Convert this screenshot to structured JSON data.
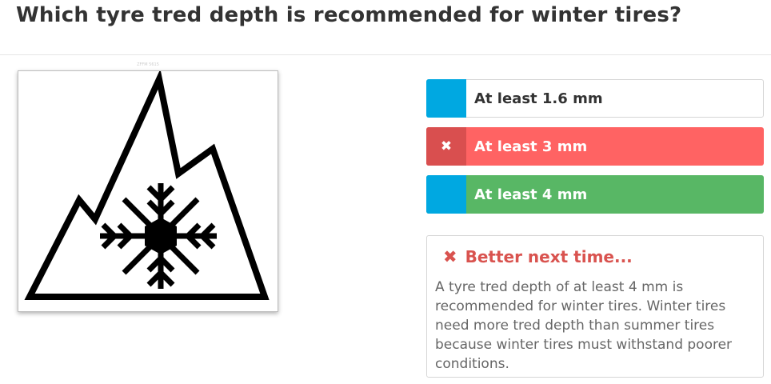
{
  "question": "Which tyre tred depth is recommended for winter tires?",
  "image": {
    "caption": "ZFFM 5615",
    "icon": "three-peak-mountain-snowflake-icon"
  },
  "answers": [
    {
      "label": "At least 1.6 mm",
      "state": "neutral",
      "marker": ""
    },
    {
      "label": "At least 3 mm",
      "state": "wrong",
      "marker": "✖"
    },
    {
      "label": "At least 4 mm",
      "state": "correct",
      "marker": ""
    }
  ],
  "feedback": {
    "icon": "✖",
    "title": "Better next time...",
    "text": "A tyre tred depth of at least 4 mm is recommended for winter tires. Winter tires need more tred depth than summer tires because winter tires must withstand poorer conditions."
  },
  "colors": {
    "neutral_marker": "#00a8e1",
    "wrong_bg": "#ff6363",
    "wrong_marker": "#d94f4f",
    "correct_bg": "#58b765",
    "feedback_title": "#d9534f"
  }
}
